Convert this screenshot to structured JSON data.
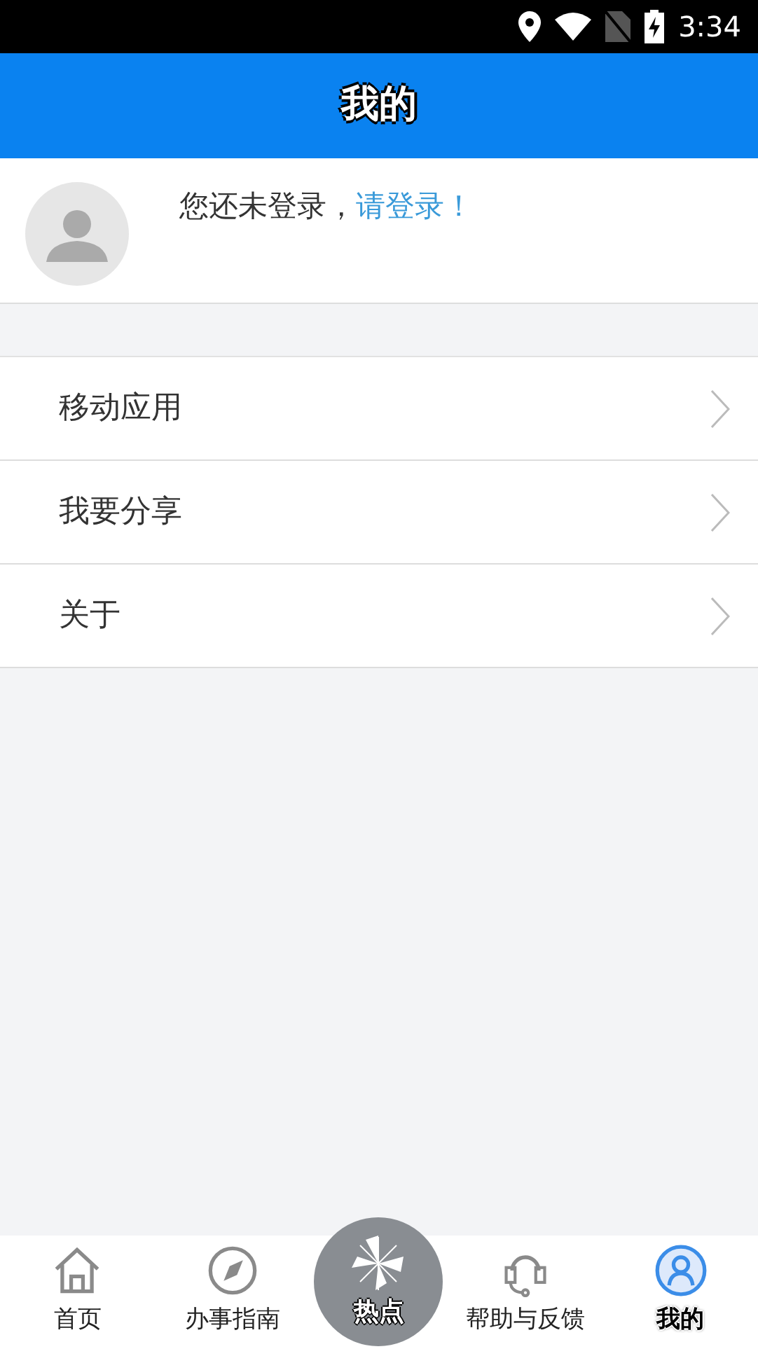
{
  "status_bar": {
    "time": "3:34"
  },
  "header": {
    "title": "我的"
  },
  "profile": {
    "prompt": "您还未登录，",
    "login_link": "请登录！"
  },
  "menu": [
    {
      "label": "移动应用"
    },
    {
      "label": "我要分享"
    },
    {
      "label": "关于"
    }
  ],
  "tab_bar": [
    {
      "kind": "home",
      "label": "首页",
      "selected": false
    },
    {
      "kind": "compass",
      "label": "办事指南",
      "selected": false
    },
    {
      "kind": "hot",
      "label": "热点",
      "selected": false
    },
    {
      "kind": "headset",
      "label": "帮助与反馈",
      "selected": false
    },
    {
      "kind": "user",
      "label": "我的",
      "selected": true
    }
  ]
}
